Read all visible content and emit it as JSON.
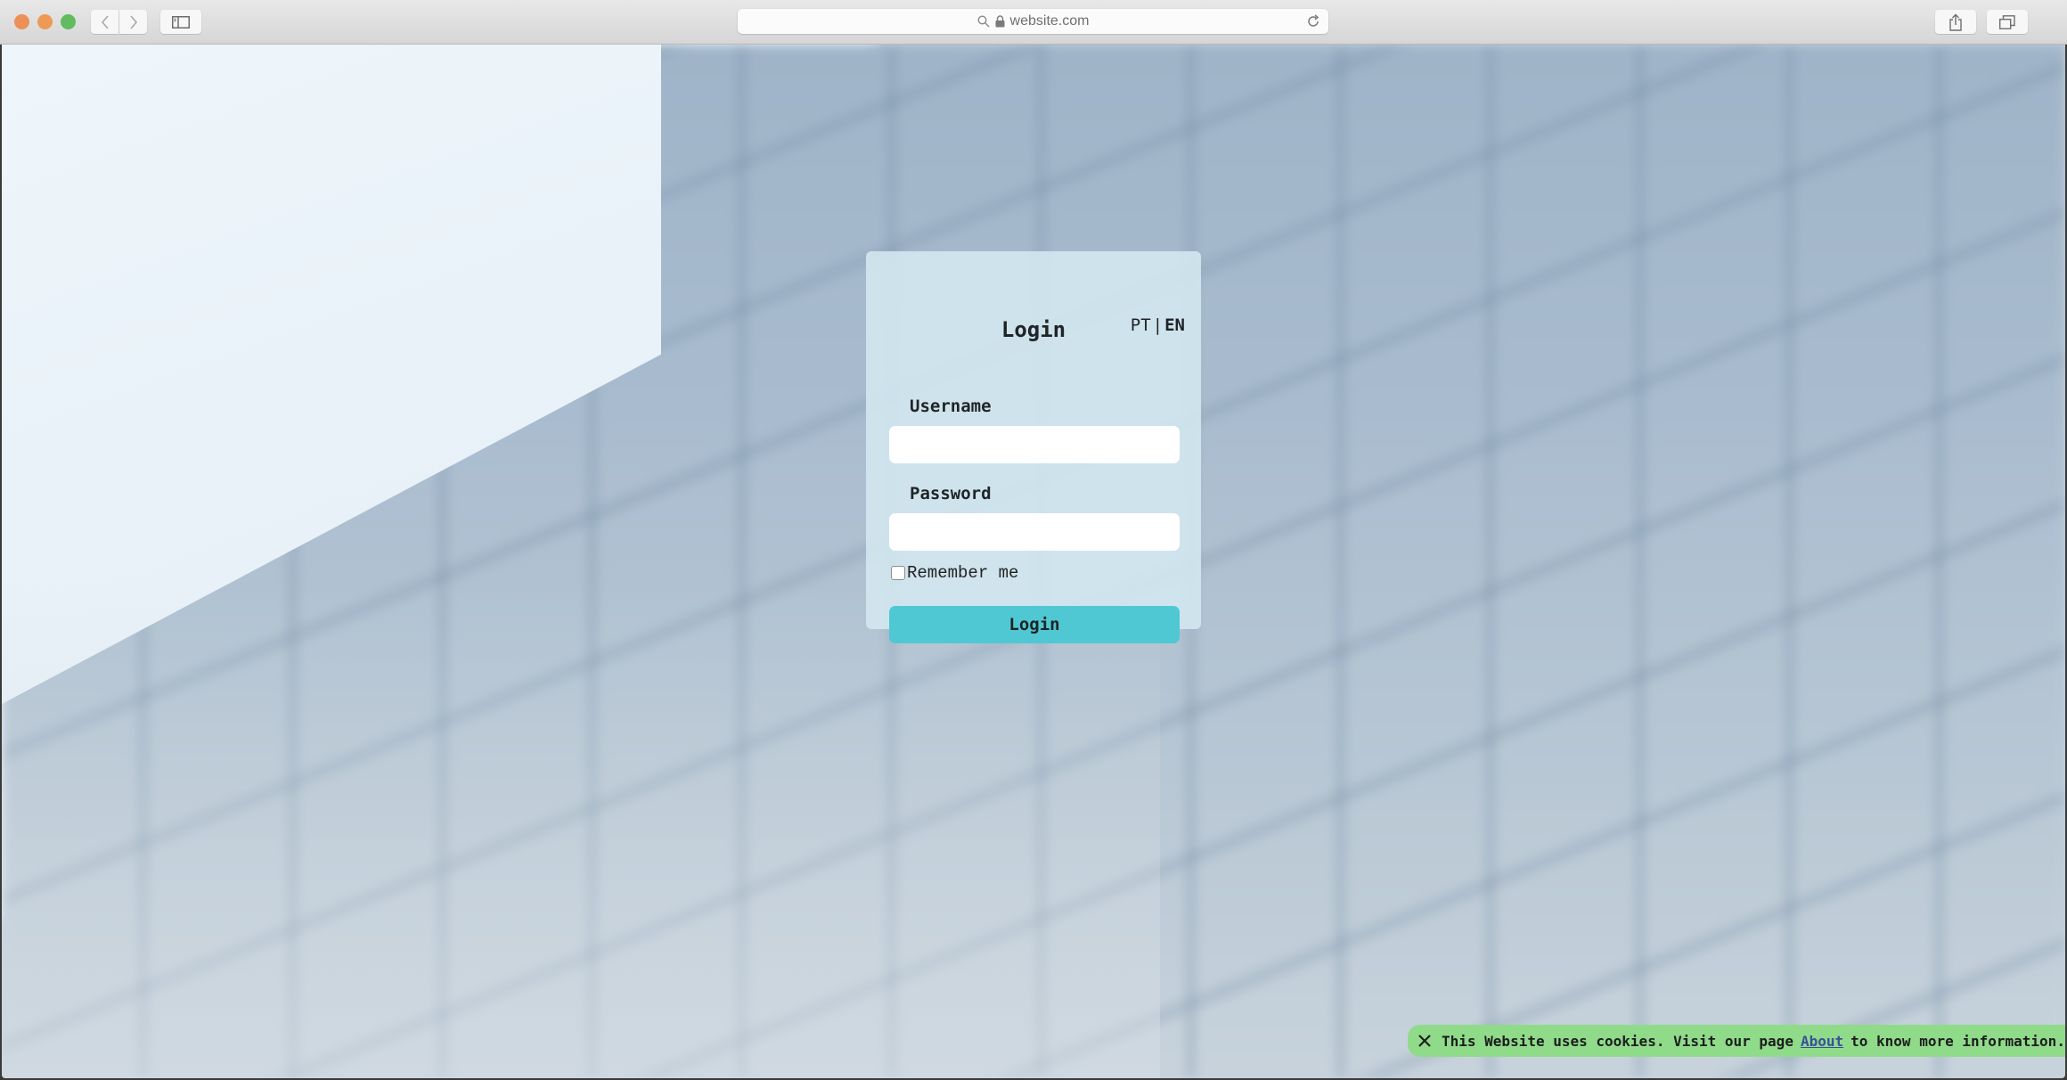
{
  "browser": {
    "url": "website.com",
    "buttons": {
      "back": "back",
      "forward": "forward",
      "sidebar": "sidebar",
      "share": "share",
      "tabs": "tabs",
      "reload": "reload"
    },
    "icons": {
      "search": "search-icon",
      "lock": "lock-icon"
    }
  },
  "login": {
    "title": "Login",
    "languages": [
      {
        "code": "PT",
        "active": false
      },
      {
        "code": "EN",
        "active": true
      }
    ],
    "language_separator": "|",
    "username": {
      "label": "Username",
      "value": "",
      "placeholder": ""
    },
    "password": {
      "label": "Password",
      "value": "",
      "placeholder": ""
    },
    "remember_me": {
      "label": "Remember me",
      "checked": false
    },
    "submit_label": "Login",
    "accent_color": "#4fc8d3"
  },
  "cookie_banner": {
    "text_before": "This Website uses cookies. Visit our page",
    "link_text": "About",
    "text_after": "to know more information.",
    "close_icon": "close-icon",
    "background_color": "#8fdb8a"
  }
}
